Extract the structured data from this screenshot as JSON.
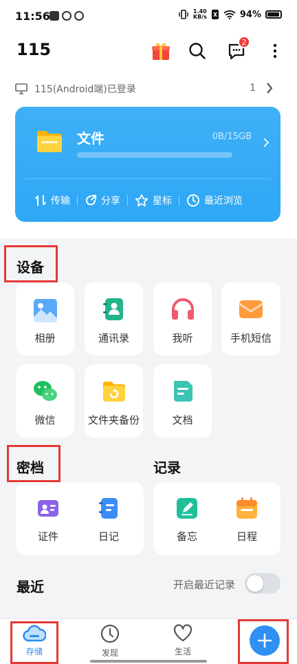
{
  "status": {
    "time": "11:56",
    "speed": "1.40",
    "speed_unit": "KB/s",
    "battery": "94%"
  },
  "header": {
    "title": "115",
    "message_badge": "2"
  },
  "login": {
    "text": "115(Android端)已登录",
    "count": "1"
  },
  "file_card": {
    "title": "文件",
    "quota": "0B/15GB",
    "usage_fraction": 0.0,
    "actions": [
      "传输",
      "分享",
      "星标",
      "最近浏览"
    ]
  },
  "devices": {
    "title": "设备",
    "items": [
      "相册",
      "通讯录",
      "我听",
      "手机短信",
      "微信",
      "文件夹备份",
      "文档"
    ]
  },
  "vault": {
    "title": "密档",
    "items": [
      "证件",
      "日记"
    ]
  },
  "records": {
    "title": "记录",
    "items": [
      "备忘",
      "日程"
    ]
  },
  "recent": {
    "title": "最近",
    "toggle_label": "开启最近记录",
    "toggle_on": false
  },
  "nav": {
    "items": [
      "存储",
      "发现",
      "生活"
    ],
    "active": "存储"
  },
  "colors": {
    "accent": "#2f8ff3",
    "card": "#36aaf6",
    "highlight": "#e53935"
  }
}
